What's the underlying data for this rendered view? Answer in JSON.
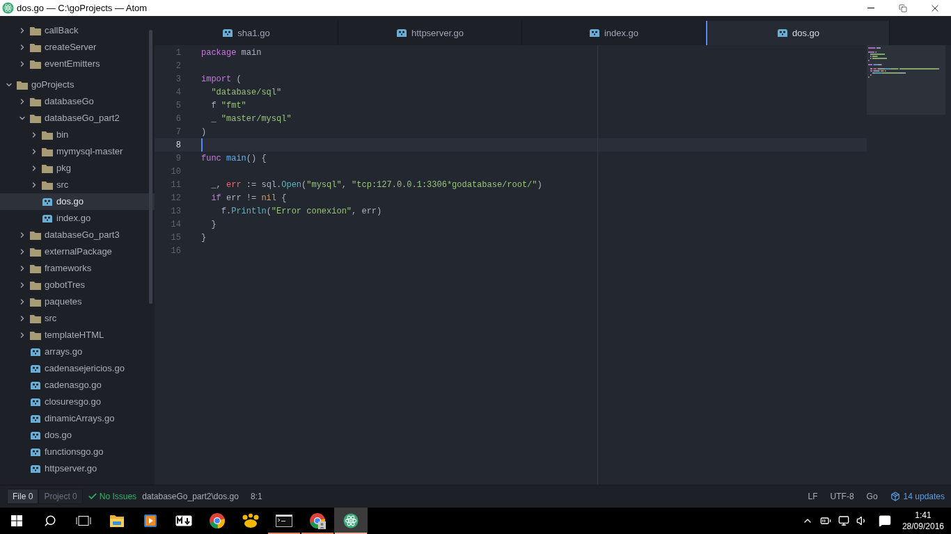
{
  "window": {
    "title": "dos.go — C:\\goProjects — Atom"
  },
  "sidebar": {
    "scrolled_items": [
      {
        "label": "callBack",
        "kind": "folder",
        "expanded": false
      },
      {
        "label": "createServer",
        "kind": "folder",
        "expanded": false
      },
      {
        "label": "eventEmitters",
        "kind": "folder",
        "expanded": false
      }
    ],
    "tree": [
      {
        "label": "goProjects",
        "kind": "folder",
        "expanded": true,
        "children": [
          {
            "label": "databaseGo",
            "kind": "folder",
            "expanded": false
          },
          {
            "label": "databaseGo_part2",
            "kind": "folder",
            "expanded": true,
            "children": [
              {
                "label": "bin",
                "kind": "folder",
                "expanded": false
              },
              {
                "label": "mymysql-master",
                "kind": "folder",
                "expanded": false
              },
              {
                "label": "pkg",
                "kind": "folder",
                "expanded": false
              },
              {
                "label": "src",
                "kind": "folder",
                "expanded": false
              },
              {
                "label": "dos.go",
                "kind": "file",
                "selected": true
              },
              {
                "label": "index.go",
                "kind": "file",
                "selected": false
              }
            ]
          },
          {
            "label": "databaseGo_part3",
            "kind": "folder",
            "expanded": false
          },
          {
            "label": "externalPackage",
            "kind": "folder",
            "expanded": false
          },
          {
            "label": "frameworks",
            "kind": "folder",
            "expanded": false
          },
          {
            "label": "gobotTres",
            "kind": "folder",
            "expanded": false
          },
          {
            "label": "paquetes",
            "kind": "folder",
            "expanded": false
          },
          {
            "label": "src",
            "kind": "folder",
            "expanded": false
          },
          {
            "label": "templateHTML",
            "kind": "folder",
            "expanded": false
          },
          {
            "label": "arrays.go",
            "kind": "file",
            "selected": false
          },
          {
            "label": "cadenasejericios.go",
            "kind": "file",
            "selected": false
          },
          {
            "label": "cadenasgo.go",
            "kind": "file",
            "selected": false
          },
          {
            "label": "closuresgo.go",
            "kind": "file",
            "selected": false
          },
          {
            "label": "dinamicArrays.go",
            "kind": "file",
            "selected": false
          },
          {
            "label": "dos.go",
            "kind": "file",
            "selected": false
          },
          {
            "label": "functionsgo.go",
            "kind": "file",
            "selected": false
          },
          {
            "label": "httpserver.go",
            "kind": "file",
            "selected": false
          }
        ]
      }
    ]
  },
  "tabs": [
    {
      "label": "sha1.go",
      "selected": false
    },
    {
      "label": "httpserver.go",
      "selected": false
    },
    {
      "label": "index.go",
      "selected": false
    },
    {
      "label": "dos.go",
      "selected": true
    }
  ],
  "editor": {
    "lines": [
      {
        "number": "1",
        "current": false,
        "tokens": [
          {
            "kind": "keyword",
            "text": "package"
          },
          {
            "kind": "plain",
            "text": " main"
          }
        ]
      },
      {
        "number": "2",
        "current": false
      },
      {
        "number": "3",
        "current": false,
        "tokens": [
          {
            "kind": "keyword",
            "text": "import"
          },
          {
            "kind": "plain",
            "text": " ("
          }
        ]
      },
      {
        "number": "4",
        "current": false,
        "tokens": [
          {
            "kind": "string",
            "text": "  \"database/sql\""
          }
        ]
      },
      {
        "number": "5",
        "current": false,
        "tokens": [
          {
            "kind": "plain",
            "text": "  f "
          },
          {
            "kind": "string",
            "text": "\"fmt\""
          }
        ]
      },
      {
        "number": "6",
        "current": false,
        "tokens": [
          {
            "kind": "plain",
            "text": "  _ "
          },
          {
            "kind": "string",
            "text": "\"master/mysql\""
          }
        ]
      },
      {
        "number": "7",
        "current": false,
        "tokens": [
          {
            "kind": "plain",
            "text": ")"
          }
        ]
      },
      {
        "number": "8",
        "current": true
      },
      {
        "number": "9",
        "current": false,
        "tokens": [
          {
            "kind": "keyword",
            "text": "func "
          },
          {
            "kind": "function",
            "text": "main"
          },
          {
            "kind": "plain",
            "text": "() {"
          }
        ]
      },
      {
        "number": "10",
        "current": false
      },
      {
        "number": "11",
        "current": false,
        "tokens": [
          {
            "kind": "plain",
            "text": "  _, "
          },
          {
            "kind": "variable",
            "text": "err"
          },
          {
            "kind": "plain",
            "text": " := sql."
          },
          {
            "kind": "method",
            "text": "Open"
          },
          {
            "kind": "plain",
            "text": "("
          },
          {
            "kind": "string",
            "text": "\"mysql\""
          },
          {
            "kind": "plain",
            "text": ", "
          },
          {
            "kind": "string",
            "text": "\"tcp:127.0.0.1:3306*godatabase/root/\""
          },
          {
            "kind": "plain",
            "text": ")"
          }
        ]
      },
      {
        "number": "12",
        "current": false,
        "tokens": [
          {
            "kind": "keyword",
            "text": "  if"
          },
          {
            "kind": "plain",
            "text": " err != "
          },
          {
            "kind": "constant",
            "text": "nil"
          },
          {
            "kind": "plain",
            "text": " {"
          }
        ]
      },
      {
        "number": "13",
        "current": false,
        "tokens": [
          {
            "kind": "plain",
            "text": "    f."
          },
          {
            "kind": "method",
            "text": "Println"
          },
          {
            "kind": "plain",
            "text": "("
          },
          {
            "kind": "string",
            "text": "\"Error conexion\""
          },
          {
            "kind": "plain",
            "text": ", err)"
          }
        ]
      },
      {
        "number": "14",
        "current": false,
        "tokens": [
          {
            "kind": "plain",
            "text": "  }"
          }
        ]
      },
      {
        "number": "15",
        "current": false,
        "tokens": [
          {
            "kind": "plain",
            "text": "}"
          }
        ]
      },
      {
        "number": "16",
        "current": false
      }
    ]
  },
  "status_bar": {
    "lint_tabs": [
      {
        "label": "File",
        "count": "0",
        "selected": true
      },
      {
        "label": "Project",
        "count": "0",
        "selected": false
      }
    ],
    "lint_status": "No Issues",
    "path": "databaseGo_part2\\dos.go",
    "cursor": "8:1",
    "line_ending": "LF",
    "encoding": "UTF-8",
    "grammar": "Go",
    "updates": "14 updates"
  },
  "taskbar": {
    "apps": [
      {
        "kind": "explorer",
        "running": false,
        "active": false
      },
      {
        "kind": "media",
        "running": false,
        "active": false
      },
      {
        "kind": "markdown",
        "running": false,
        "active": false
      },
      {
        "kind": "chrome",
        "running": false,
        "active": false
      },
      {
        "kind": "paw",
        "running": false,
        "active": false
      },
      {
        "kind": "terminal",
        "running": true,
        "active": false
      },
      {
        "kind": "chrome-user",
        "running": true,
        "active": false
      },
      {
        "kind": "atom",
        "running": true,
        "active": true
      }
    ],
    "time": "1:41",
    "date": "28/09/2016"
  }
}
